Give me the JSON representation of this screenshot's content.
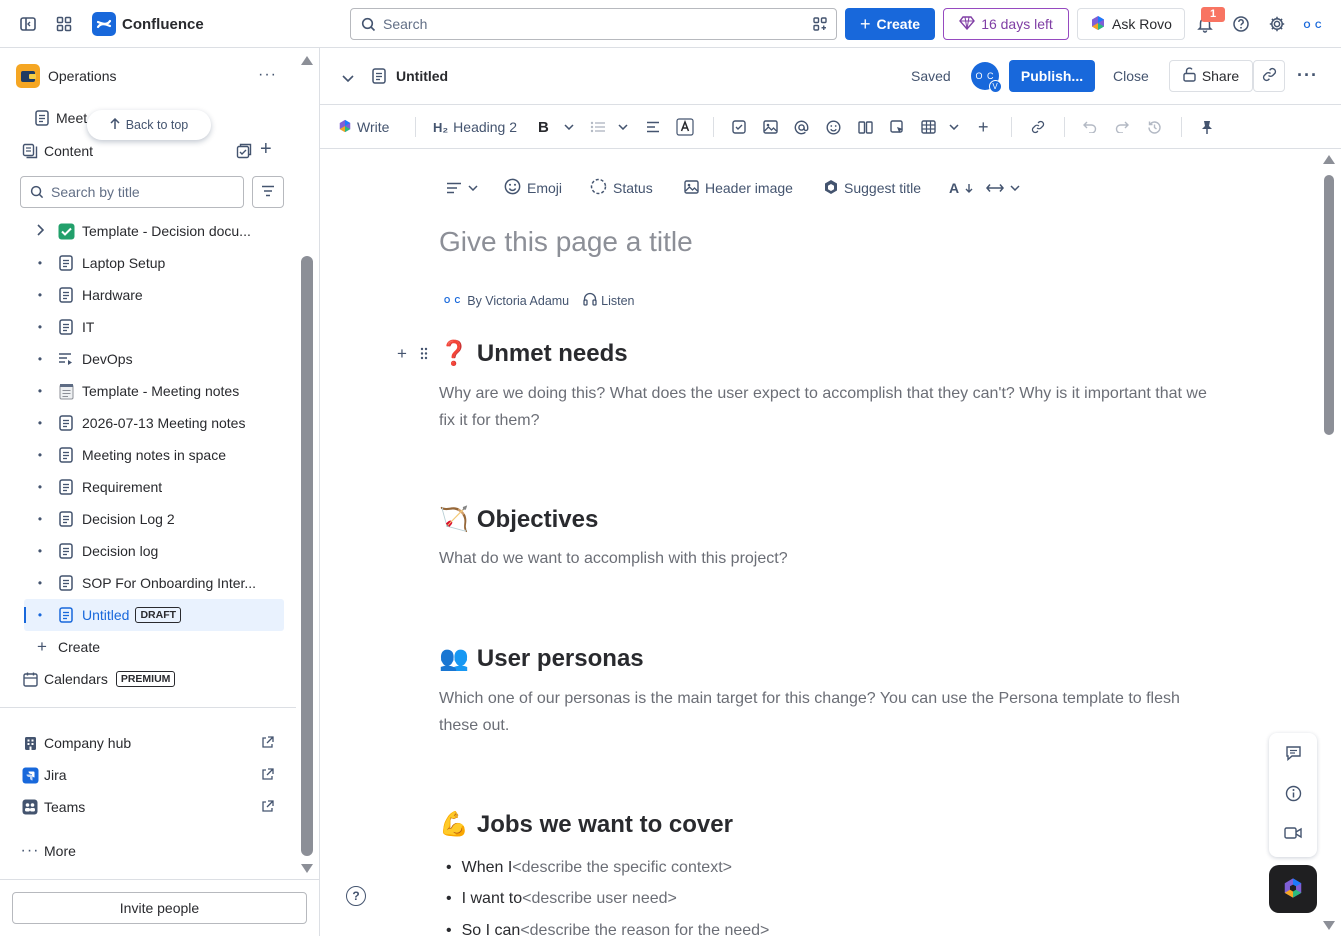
{
  "topnav": {
    "app_name": "Confluence",
    "search_placeholder": "Search",
    "create_label": "Create",
    "trial_label": "16 days left",
    "rovo_label": "Ask Rovo",
    "notification_count": "1",
    "user_initials": "O C"
  },
  "sidebar": {
    "space_name": "Operations",
    "recent_item": "Meet",
    "back_to_top": "Back to top",
    "content_label": "Content",
    "search_placeholder": "Search by title",
    "tree": [
      {
        "label": "Template - Decision docu...",
        "icon": "check-emoji"
      },
      {
        "label": "Laptop Setup",
        "icon": "page-icon"
      },
      {
        "label": "Hardware",
        "icon": "page-icon"
      },
      {
        "label": "IT",
        "icon": "page-icon"
      },
      {
        "label": "DevOps",
        "icon": "live-doc-icon"
      },
      {
        "label": "Template - Meeting notes",
        "icon": "notepad-emoji"
      },
      {
        "label": "2026-07-13 Meeting notes",
        "icon": "page-icon"
      },
      {
        "label": "Meeting notes in space",
        "icon": "page-icon"
      },
      {
        "label": "Requirement",
        "icon": "page-icon"
      },
      {
        "label": "Decision Log 2",
        "icon": "page-icon"
      },
      {
        "label": "Decision log",
        "icon": "page-icon"
      },
      {
        "label": "SOP For Onboarding Inter...",
        "icon": "page-icon"
      },
      {
        "label": "Untitled",
        "icon": "page-icon",
        "badge": "DRAFT"
      }
    ],
    "create_label": "Create",
    "calendars_label": "Calendars",
    "calendars_badge": "PREMIUM",
    "links": [
      {
        "label": "Company hub"
      },
      {
        "label": "Jira"
      },
      {
        "label": "Teams"
      }
    ],
    "more_label": "More",
    "invite_label": "Invite people"
  },
  "editor_header": {
    "page_title": "Untitled",
    "saved_label": "Saved",
    "avatar_initials": "O C",
    "avatar_badge": "V",
    "publish_label": "Publish...",
    "close_label": "Close",
    "share_label": "Share"
  },
  "toolbar": {
    "write_label": "Write",
    "heading_label": "Heading 2",
    "heading_prefix": "H₂"
  },
  "insert_bar": {
    "emoji": "Emoji",
    "status": "Status",
    "header_image": "Header image",
    "suggest_title": "Suggest title"
  },
  "page": {
    "title_placeholder": "Give this page a title",
    "author_initials": "O C",
    "byline": "By Victoria Adamu",
    "listen": "Listen",
    "sections": [
      {
        "emoji": "❓",
        "heading": "Unmet needs",
        "text": "Why are we doing this? What does the user expect to accomplish that they can't? Why is it important that we fix it for them?"
      },
      {
        "emoji": "🏹",
        "heading": "Objectives",
        "text": "What do we want to accomplish with this project?"
      },
      {
        "emoji": "👥",
        "heading": "User personas",
        "text": "Which one of our personas is the main target for this change? You can use the Persona template to flesh these out."
      },
      {
        "emoji": "💪",
        "heading": "Jobs we want to cover",
        "text": ""
      }
    ],
    "jobs": [
      {
        "lead": "When I",
        "ph": "<describe the specific context>"
      },
      {
        "lead": "I want to",
        "ph": "<describe user need>"
      },
      {
        "lead": "So I can",
        "ph": "<describe the reason for the need>"
      }
    ]
  },
  "colors": {
    "brand": "#1868db",
    "trial": "#803fa5",
    "active_bg": "#e9f2fe"
  }
}
